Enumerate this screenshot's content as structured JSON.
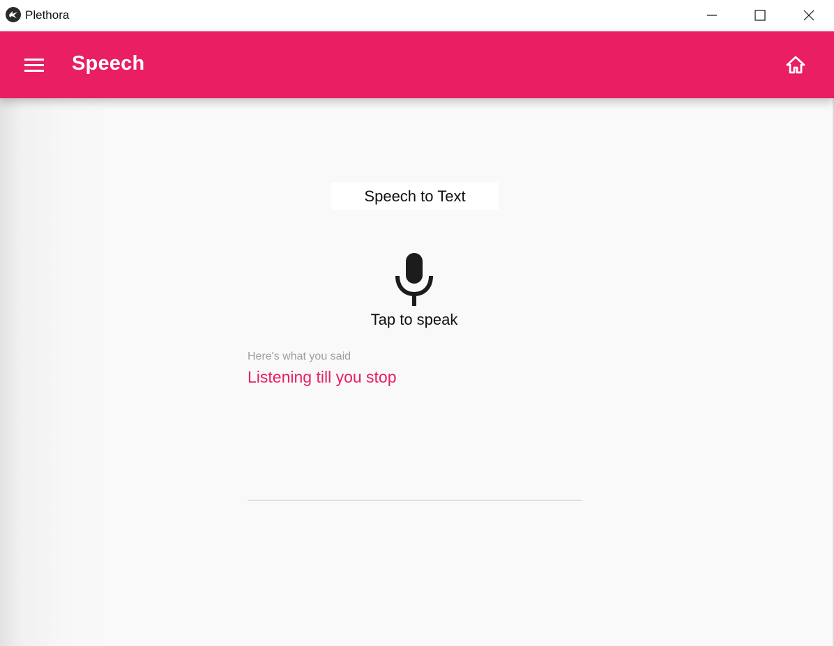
{
  "window": {
    "title": "Plethora",
    "icon": "kivy-logo-icon",
    "controls": [
      "minimize-icon",
      "maximize-icon",
      "close-icon"
    ]
  },
  "toolbar": {
    "title": "Speech",
    "left_icon": "menu-icon",
    "right_icon": "home-icon",
    "color": "#e91e63"
  },
  "main": {
    "section_label": "Speech to Text",
    "mic_icon": "microphone-icon",
    "tap_label": "Tap to speak",
    "result_caption": "Here's what you said",
    "result_text": "Listening till you stop"
  },
  "colors": {
    "accent": "#e91e63",
    "background": "#f9f9f9",
    "caption": "#9e9e9e"
  }
}
